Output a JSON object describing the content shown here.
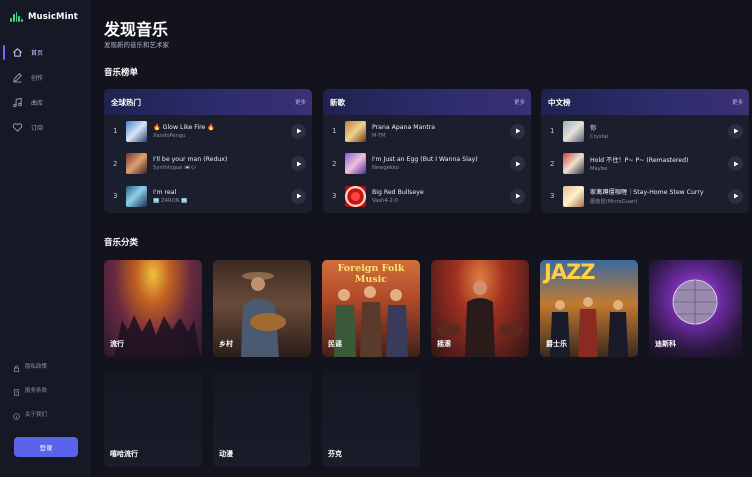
{
  "app": {
    "name": "MusicMint"
  },
  "sidebar": {
    "nav": [
      {
        "label": "首页",
        "icon": "home-icon",
        "active": true
      },
      {
        "label": "创作",
        "icon": "pencil-icon",
        "active": false
      },
      {
        "label": "曲库",
        "icon": "music-note-icon",
        "active": false
      },
      {
        "label": "订阅",
        "icon": "heart-icon",
        "active": false
      }
    ],
    "footer_links": [
      {
        "label": "隐私政策",
        "icon": "lock-icon"
      },
      {
        "label": "服务条款",
        "icon": "document-icon"
      },
      {
        "label": "关于我们",
        "icon": "info-icon"
      }
    ],
    "login_label": "登录"
  },
  "header": {
    "title": "发现音乐",
    "subtitle": "发现新的音乐和艺术家"
  },
  "charts_section": {
    "title": "音乐榜单",
    "more_label": "更多",
    "charts": [
      {
        "name": "全球热门",
        "tracks": [
          {
            "rank": "1",
            "title": "🔥 Glow Like Fire 🔥",
            "artist": "XandoPengu"
          },
          {
            "rank": "2",
            "title": "I'll be your man (Redux)",
            "artist": "Synthlogue 📼🎶"
          },
          {
            "rank": "3",
            "title": "I'm real",
            "artist": "🆗 Z4RON 🆗"
          }
        ]
      },
      {
        "name": "新歌",
        "tracks": [
          {
            "rank": "1",
            "title": "Prana Apana Mantra",
            "artist": "M-TM"
          },
          {
            "rank": "2",
            "title": "I'm Just an Egg (But I Wanna Slay)",
            "artist": "Newgekko"
          },
          {
            "rank": "3",
            "title": "Big Red Bullseye",
            "artist": "Vash4-2-0"
          }
        ]
      },
      {
        "name": "中文榜",
        "tracks": [
          {
            "rank": "1",
            "title": "你",
            "artist": "Crystal"
          },
          {
            "rank": "2",
            "title": "Hold 不住！P~ P~ (Remastered)",
            "artist": "Maybe"
          },
          {
            "rank": "3",
            "title": "家禽蹲僵咖喱｜Stay-Home Stew Curry",
            "artist": "蘑菇冒(MicroGuan)"
          }
        ]
      }
    ]
  },
  "genres_section": {
    "title": "音乐分类",
    "genres": [
      {
        "label": "流行"
      },
      {
        "label": "乡村"
      },
      {
        "label": "民谣",
        "banner": "Foreign Folk Music"
      },
      {
        "label": "摇滚"
      },
      {
        "label": "爵士乐",
        "banner": "JAZZ"
      },
      {
        "label": "迪斯科"
      },
      {
        "label": "嘻哈流行"
      },
      {
        "label": "动漫"
      },
      {
        "label": "芬克"
      }
    ]
  },
  "colors": {
    "accent": "#5b63e8",
    "logo": "#3ddc84",
    "background": "#12131d",
    "card": "#1b1e2c"
  }
}
